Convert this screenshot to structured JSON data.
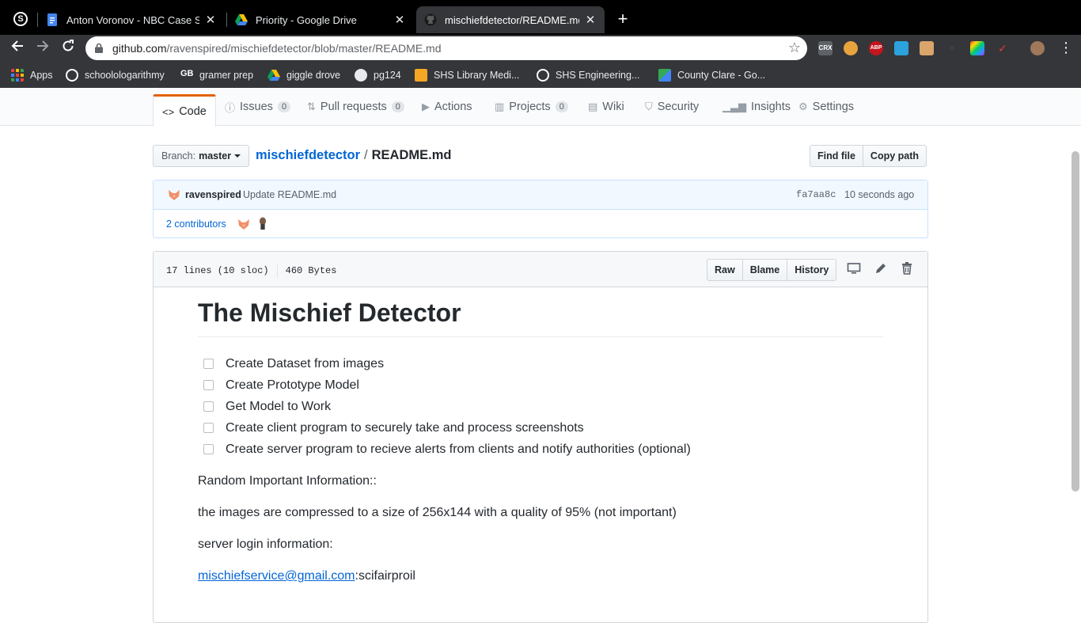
{
  "browser": {
    "tabs": [
      {
        "title": "Anton Voronov - NBC Case Stu",
        "active": false
      },
      {
        "title": "Priority - Google Drive",
        "active": false
      },
      {
        "title": "mischiefdetector/README.md",
        "active": true
      }
    ],
    "url_host": "github.com",
    "url_path": "/ravenspired/mischiefdetector/blob/master/README.md",
    "extensions": [
      "CRX",
      "ABP"
    ],
    "bookmarks": [
      {
        "label": "Apps"
      },
      {
        "label": "schoolologarithmy"
      },
      {
        "label": "gramer prep"
      },
      {
        "label": "giggle drove"
      },
      {
        "label": "pg124"
      },
      {
        "label": "SHS Library Medi..."
      },
      {
        "label": "SHS Engineering..."
      },
      {
        "label": "County Clare - Go..."
      }
    ]
  },
  "repo_nav": {
    "items": [
      {
        "label": "Code",
        "icon": "code-icon"
      },
      {
        "label": "Issues",
        "count": "0",
        "icon": "issue-icon"
      },
      {
        "label": "Pull requests",
        "count": "0",
        "icon": "pull-request-icon"
      },
      {
        "label": "Actions",
        "icon": "play-icon"
      },
      {
        "label": "Projects",
        "count": "0",
        "icon": "project-icon"
      },
      {
        "label": "Wiki",
        "icon": "book-icon"
      },
      {
        "label": "Security",
        "icon": "shield-icon"
      },
      {
        "label": "Insights",
        "icon": "graph-icon"
      },
      {
        "label": "Settings",
        "icon": "gear-icon"
      }
    ]
  },
  "branch": {
    "prefix": "Branch:",
    "name": "master"
  },
  "breadcrumb": {
    "repo": "mischiefdetector",
    "separator": "/",
    "file": "README.md"
  },
  "file_nav": {
    "find_file": "Find file",
    "copy_path": "Copy path"
  },
  "commit": {
    "author": "ravenspired",
    "message": "Update README.md",
    "sha": "fa7aa8c",
    "time": "10 seconds ago",
    "contributors": "2 contributors"
  },
  "file": {
    "lines": "17 lines (10 sloc)",
    "size": "460 Bytes",
    "actions": {
      "raw": "Raw",
      "blame": "Blame",
      "history": "History"
    }
  },
  "readme": {
    "title": "The Mischief Detector",
    "tasks": [
      "Create Dataset from images",
      "Create Prototype Model",
      "Get Model to Work",
      "Create client program to securely take and process screenshots",
      "Create server program to recieve alerts from clients and notify authorities (optional)"
    ],
    "p1": "Random Important Information::",
    "p2": "the images are compressed to a size of 256x144 with a quality of 95% (not important)",
    "p3": "server login information:",
    "email": "mischiefservice@gmail.com",
    "password_suffix": ":scifairproil"
  },
  "colors": {
    "accent_tab": "#e36209",
    "link": "#0366d6"
  }
}
